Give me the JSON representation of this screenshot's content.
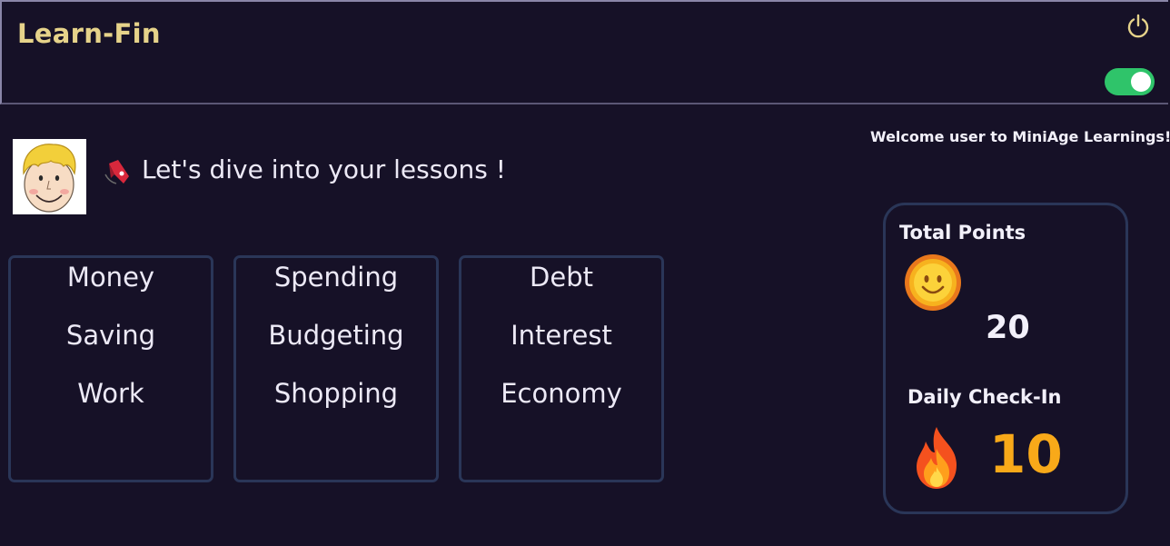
{
  "header": {
    "app_title": "Learn-Fin",
    "power_icon": "power-icon",
    "theme_toggle_state": "on"
  },
  "welcome_text": "Welcome user to MiniAge Learnings!",
  "lessons": {
    "heading": "Let's dive into your lessons !",
    "avatar_icon": "cartoon-boy-avatar",
    "bookmark_icon": "bookmark-icon",
    "cards": [
      {
        "items": [
          "Money",
          "Saving",
          "Work"
        ]
      },
      {
        "items": [
          "Spending",
          "Budgeting",
          "Shopping"
        ]
      },
      {
        "items": [
          "Debt",
          "Interest",
          "Economy"
        ]
      }
    ]
  },
  "stats": {
    "total_points_label": "Total Points",
    "total_points_value": "20",
    "coin_icon": "smiley-coin-icon",
    "daily_checkin_label": "Daily Check-In",
    "daily_checkin_value": "10",
    "fire_icon": "fire-icon"
  },
  "colors": {
    "background": "#161127",
    "title": "#e6d38a",
    "toggle": "#2fc46a",
    "card_border": "#2a3658",
    "streak": "#f8a919"
  }
}
